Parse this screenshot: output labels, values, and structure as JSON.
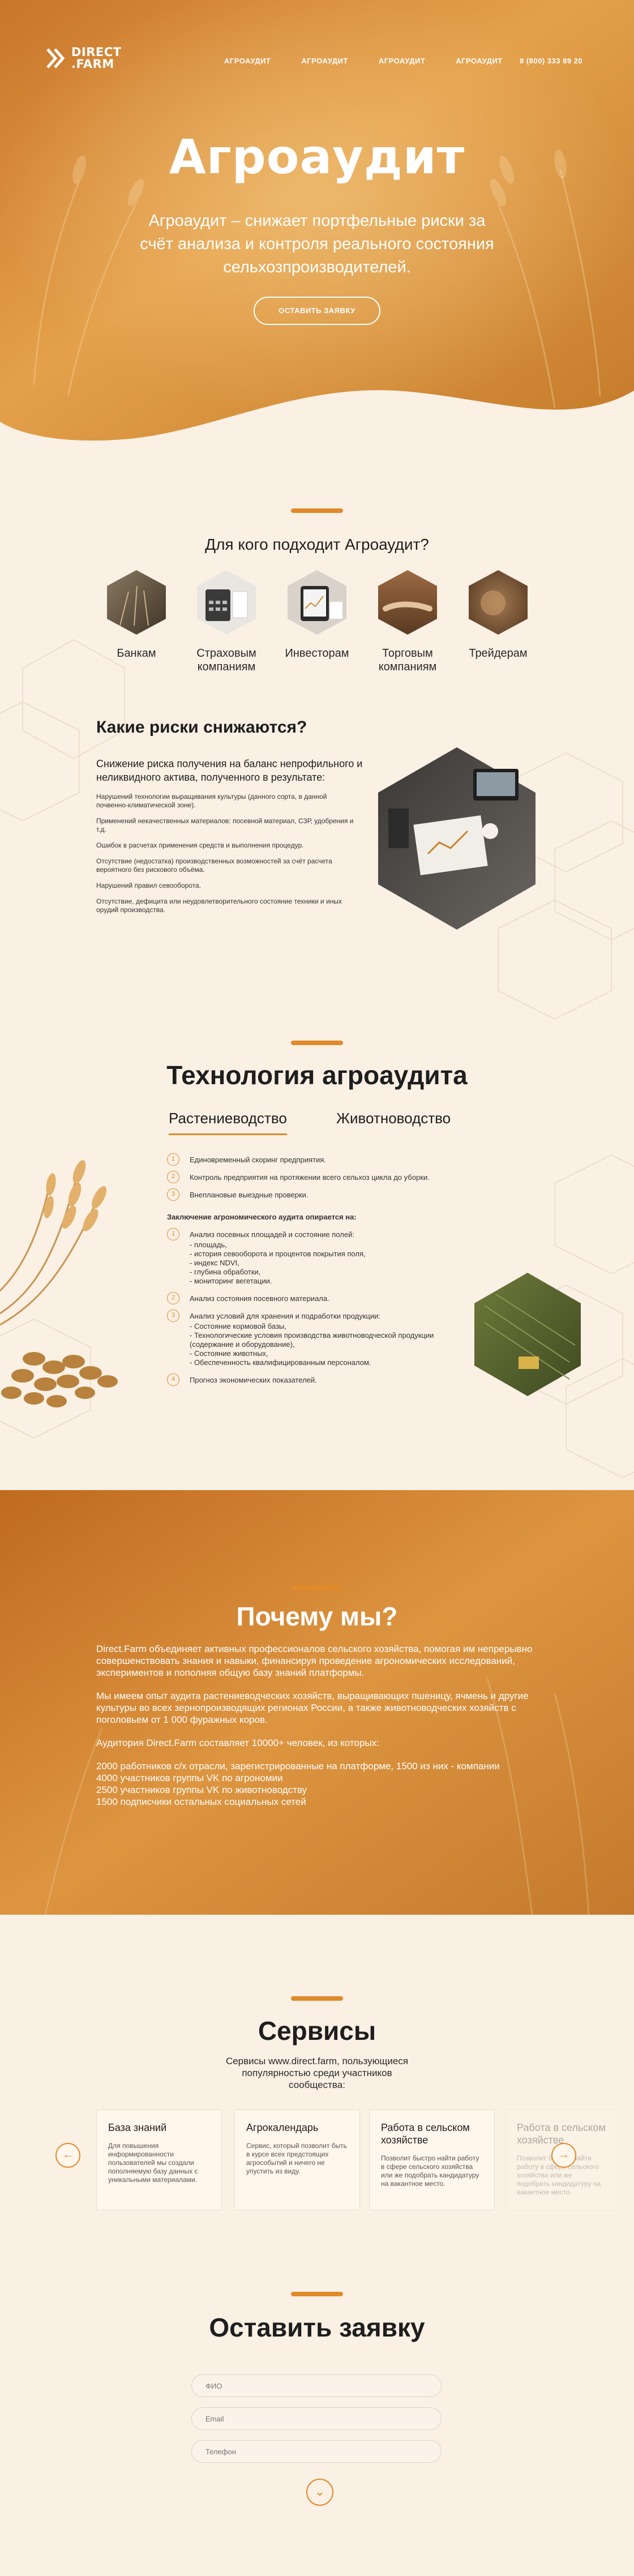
{
  "header": {
    "logo_line1": "DIRECT",
    "logo_line2": ".FARM",
    "nav": [
      "АГРОАУДИТ",
      "АГРОАУДИТ",
      "АГРОАУДИТ",
      "АГРОАУДИТ"
    ],
    "phone": "8 (800) 333 89 20"
  },
  "hero": {
    "title": "Агроаудит",
    "subtitle": "Агроаудит – снижает портфельные риски за счёт анализа и контроля реального состояния сельхозпроизводителей.",
    "button": "ОСТАВИТЬ ЗАЯВКУ"
  },
  "audience": {
    "title": "Для кого подходит Агроаудит?",
    "items": [
      {
        "label": "Банкам",
        "icon": "wheat-field-photo"
      },
      {
        "label": "Страховым компаниям",
        "icon": "calculator-photo"
      },
      {
        "label": "Инвесторам",
        "icon": "tablet-photo"
      },
      {
        "label": "Торговым компаниям",
        "icon": "handshake-photo"
      },
      {
        "label": "Трейдерам",
        "icon": "grain-photo"
      }
    ]
  },
  "risks": {
    "title": "Какие риски снижаются?",
    "lead": "Снижение риска получения на баланс непрофильного и неликвидного актива, полученного в результате:",
    "items": [
      "Нарушений технологии выращивания культуры (данного сорта, в данной почвенно-климатической зоне).",
      "Применений некачественных материалов: посевной материал, СЗР, удобрения и т.д.",
      "Ошибок в расчетах применения средств и выполнения процедур.",
      "Отсутствие (недостатка) производственных возможностей за счёт расчета вероятного без рискового объёма.",
      "Нарушений правил севооборота.",
      "Отсутствие, дефицита или неудовлетворительного состояние техники и иных орудий производства."
    ]
  },
  "technology": {
    "title": "Технология агроаудита",
    "tabs": [
      "Растениеводство",
      "Животноводство"
    ],
    "steps": [
      {
        "n": "1",
        "text": "Единовременный скоринг предприятия."
      },
      {
        "n": "2",
        "text": "Контроль предприятия на протяжении всего сельхоз цикла до уборки."
      },
      {
        "n": "3",
        "text": "Внеплановые выездные проверки."
      }
    ],
    "conclusion_heading": "Заключение агрономического аудита опирается на:",
    "analysis": [
      {
        "n": "1",
        "text": "Анализ посевных площадей и состояние полей:",
        "sub": [
          "- площадь,",
          "- история севооборота и процентов покрытия поля,",
          "- индекс NDVI,",
          "- глубина обработки,",
          "- мониторинг вегетации."
        ]
      },
      {
        "n": "2",
        "text": "Анализ состояния посевного материала.",
        "sub": []
      },
      {
        "n": "3",
        "text": "Анализ условий для хранения и подработки продукции:",
        "sub": [
          "- Состояние кормовой базы,",
          "- Технологические условия производства животноводческой продукции (содержание и оборудование),",
          "- Состояние животных,",
          "- Обеспеченность квалифицированным персоналом."
        ]
      },
      {
        "n": "4",
        "text": "Прогноз экономических показателей.",
        "sub": []
      }
    ]
  },
  "why": {
    "title": "Почему мы?",
    "paragraphs": [
      "Direct.Farm объединяет активных профессионалов сельского хозяйства, помогая им непрерывно совершенствовать знания и навыки, финансируя проведение агрономических исследований, экспериментов и пополняя общую базу знаний платформы.",
      "Мы имеем опыт аудита растениеводческих хозяйств, выращивающих пшеницу, ячмень и другие культуры во всех зернопроизводящих регионах России, а также животноводческих хозяйств с поголовьем от 1 000 фуражных коров.",
      "Аудитория Direct.Farm составляет 10000+ человек, из которых:"
    ],
    "stats": [
      "2000 работников с/х отрасли, зарегистрированные на платформе, 1500 из них - компании",
      "4000 участников группы VK по агрономии",
      "2500 участников группы VK по животноводству",
      "1500 подписчики остальных социальных сетей"
    ]
  },
  "services": {
    "title": "Сервисы",
    "subtitle": "Сервисы www.direct.farm, пользующиеся популярностью среди участников сообщества:",
    "cards": [
      {
        "title": "База знаний",
        "desc": "Для повышения информированности пользователей мы создали пополняемую базу данных с уникальными материалами."
      },
      {
        "title": "Агрокалендарь",
        "desc": "Сервис, который позволит быть в курсе всех предстоящих агрособытий и ничего не упустить из виду."
      },
      {
        "title": "Работа в сельском хозяйстве",
        "desc": "Позволит быстро найти работу в сфере сельского хозяйства или же подобрать кандидатуру на вакантное место."
      },
      {
        "title": "Работа в сельском хозяйстве",
        "desc": "Позволит быстро найти работу в сфере сельского хозяйства или же подобрать кандидатуру на вакантное место."
      }
    ]
  },
  "form": {
    "title": "Оставить заявку",
    "fio_placeholder": "ФИО",
    "email_placeholder": "Email",
    "phone_placeholder": "Телефон"
  },
  "colors": {
    "accent": "#e08a2a",
    "hero_orange": "#d8892c",
    "background": "#faf0e4"
  }
}
